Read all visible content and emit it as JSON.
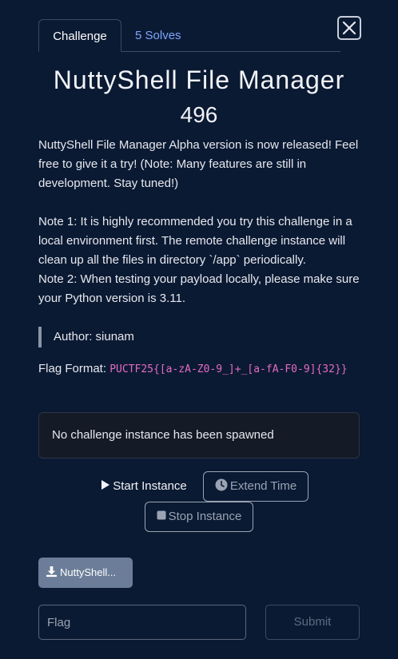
{
  "tabs": {
    "challenge": "Challenge",
    "solves": "5 Solves"
  },
  "close_icon": "close-icon",
  "challenge": {
    "name": "NuttyShell File Manager",
    "points": "496",
    "description_1": "NuttyShell File Manager Alpha version is now released! Feel free to give it a try! (Note: Many features are still in development. Stay tuned!)",
    "description_2": "Note 1: It is highly recommended you try this challenge in a local environment first. The remote challenge instance will clean up all the files in directory `/app` periodically.",
    "description_3": "Note 2: When testing your payload locally, please make sure your Python version is 3.11.",
    "author": "Author: siunam",
    "flag_format_label": "Flag Format:",
    "flag_format_value": "PUCTF25{[a-zA-Z0-9_]+_[a-fA-F0-9]{32}}"
  },
  "instance": {
    "status": "No challenge instance has been spawned",
    "start_label": "Start Instance",
    "extend_label": "Extend Time",
    "stop_label": "Stop Instance"
  },
  "download": {
    "label": "NuttyShell..."
  },
  "submission": {
    "placeholder": "Flag",
    "submit_label": "Submit"
  },
  "colors": {
    "background": "#0b1a33",
    "accent_link": "#7ea6ff",
    "flag_code": "#e36bc3",
    "download_button": "#6b7d98"
  }
}
